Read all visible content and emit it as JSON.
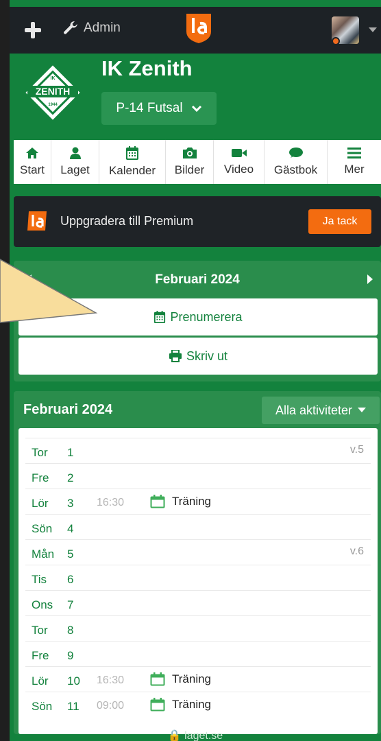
{
  "navbar": {
    "admin_label": "Admin",
    "icons": [
      "plus-icon",
      "wrench-icon",
      "laget-logo",
      "avatar",
      "caret-down-icon"
    ]
  },
  "club": {
    "name": "IK Zenith",
    "badge_top": "IK",
    "badge_name": "ZENITH",
    "badge_year": "1944",
    "team_select": "P-14 Futsal"
  },
  "tabs": [
    {
      "label": "Start",
      "icon": "home-icon"
    },
    {
      "label": "Laget",
      "icon": "user-icon"
    },
    {
      "label": "Kalender",
      "icon": "calendar-icon"
    },
    {
      "label": "Bilder",
      "icon": "camera-icon"
    },
    {
      "label": "Video",
      "icon": "video-icon"
    },
    {
      "label": "Gästbok",
      "icon": "chat-icon"
    },
    {
      "label": "Mer",
      "icon": "menu-icon"
    }
  ],
  "premium": {
    "text": "Uppgradera till Premium",
    "button": "Ja tack"
  },
  "calendar_nav": {
    "month": "Februari 2024",
    "subscribe": "Prenumerera",
    "print": "Skriv ut"
  },
  "list": {
    "title": "Februari 2024",
    "filter": "Alla aktiviteter",
    "rows": [
      {
        "day": "Tor",
        "num": "1",
        "time": "",
        "event": "",
        "week": "v.5"
      },
      {
        "day": "Fre",
        "num": "2",
        "time": "",
        "event": "",
        "week": ""
      },
      {
        "day": "Lör",
        "num": "3",
        "time": "16:30",
        "event": "Träning",
        "week": ""
      },
      {
        "day": "Sön",
        "num": "4",
        "time": "",
        "event": "",
        "week": ""
      },
      {
        "day": "Mån",
        "num": "5",
        "time": "",
        "event": "",
        "week": "v.6"
      },
      {
        "day": "Tis",
        "num": "6",
        "time": "",
        "event": "",
        "week": ""
      },
      {
        "day": "Ons",
        "num": "7",
        "time": "",
        "event": "",
        "week": ""
      },
      {
        "day": "Tor",
        "num": "8",
        "time": "",
        "event": "",
        "week": ""
      },
      {
        "day": "Fre",
        "num": "9",
        "time": "",
        "event": "",
        "week": ""
      },
      {
        "day": "Lör",
        "num": "10",
        "time": "16:30",
        "event": "Träning",
        "week": ""
      },
      {
        "day": "Sön",
        "num": "11",
        "time": "09:00",
        "event": "Träning",
        "week": ""
      }
    ]
  },
  "footer": "laget.se",
  "colors": {
    "green": "#13823d",
    "panel_green": "#2a8d4c",
    "dark": "#1d2226",
    "orange": "#f36c10"
  }
}
